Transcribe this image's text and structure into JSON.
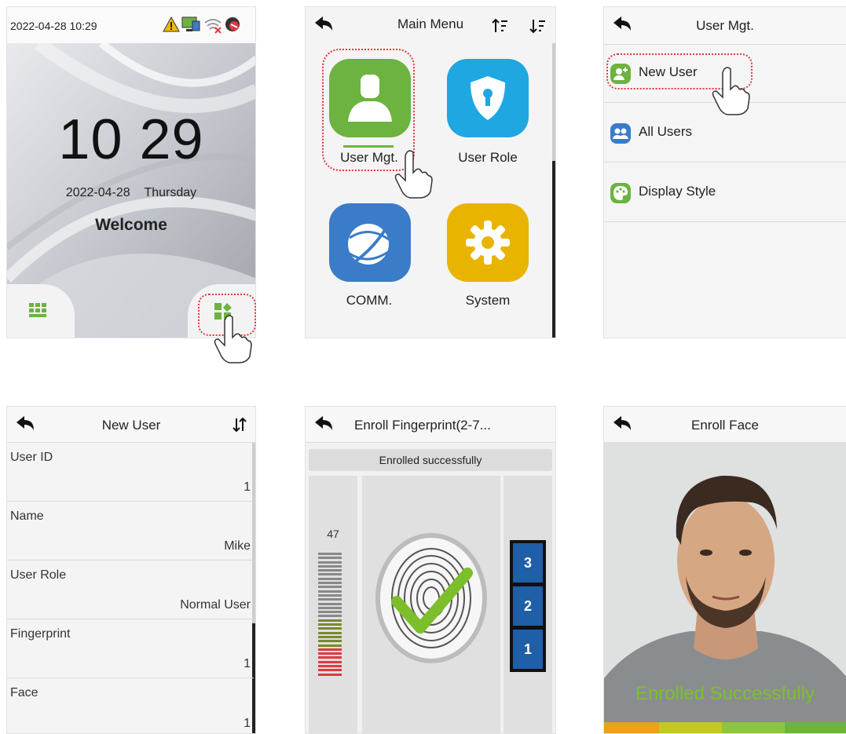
{
  "home": {
    "datetime": "2022-04-28 10:29",
    "time": "10 29",
    "date": "2022-04-28",
    "weekday": "Thursday",
    "welcome": "Welcome",
    "status_icons": [
      "warning-icon",
      "network-icon",
      "wifi-off-icon",
      "alarm-off-icon"
    ]
  },
  "main_menu": {
    "title": "Main Menu",
    "tiles": [
      {
        "label": "User Mgt.",
        "icon": "user-icon",
        "color": "#6cb33f"
      },
      {
        "label": "User Role",
        "icon": "shield-icon",
        "color": "#1ea7e1"
      },
      {
        "label": "COMM.",
        "icon": "globe-icon",
        "color": "#3a7cc8"
      },
      {
        "label": "System",
        "icon": "gear-icon",
        "color": "#e8b400"
      }
    ]
  },
  "user_mgt": {
    "title": "User Mgt.",
    "items": [
      {
        "label": "New User",
        "icon": "add-user-icon",
        "color": "#6cb33f"
      },
      {
        "label": "All Users",
        "icon": "users-icon",
        "color": "#3a7cc8"
      },
      {
        "label": "Display Style",
        "icon": "palette-icon",
        "color": "#6cb33f"
      }
    ]
  },
  "new_user": {
    "title": "New User",
    "fields": [
      {
        "label": "User ID",
        "value": "1"
      },
      {
        "label": "Name",
        "value": "Mike"
      },
      {
        "label": "User Role",
        "value": "Normal User"
      },
      {
        "label": "Fingerprint",
        "value": "1"
      },
      {
        "label": "Face",
        "value": "1"
      }
    ]
  },
  "enroll_fp": {
    "title": "Enroll Fingerprint(2-7...",
    "status": "Enrolled successfully",
    "quality": "47",
    "steps": [
      "3",
      "2",
      "1"
    ]
  },
  "enroll_face": {
    "title": "Enroll Face",
    "status": "Enrolled Successfully"
  },
  "colors": {
    "accent_green": "#6cb33f",
    "highlight_red": "#e0393e",
    "step_blue": "#1f5fa8"
  }
}
